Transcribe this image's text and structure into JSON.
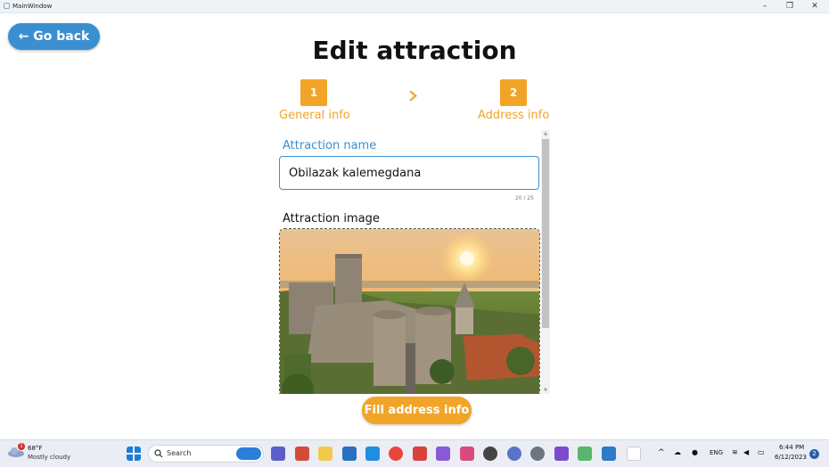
{
  "window": {
    "title": "MainWindow"
  },
  "nav": {
    "go_back": "← Go back"
  },
  "page": {
    "title": "Edit attraction"
  },
  "stepper": {
    "steps": [
      {
        "number": "1",
        "label": "General info"
      },
      {
        "number": "2",
        "label": "Address info"
      }
    ]
  },
  "form": {
    "name_label": "Attraction name",
    "name_value": "Obilazak kalemegdana",
    "name_counter": "20 / 25",
    "image_label": "Attraction image"
  },
  "actions": {
    "fill_address": "Fill address info"
  },
  "taskbar": {
    "weather_temp": "68°F",
    "weather_condition": "Mostly cloudy",
    "weather_badge": "1",
    "search_placeholder": "Search",
    "language": "ENG",
    "time": "6:44 PM",
    "date": "6/12/2023",
    "notifications": "2"
  },
  "colors": {
    "accent_blue": "#3a8fd1",
    "accent_orange": "#f2a428"
  }
}
